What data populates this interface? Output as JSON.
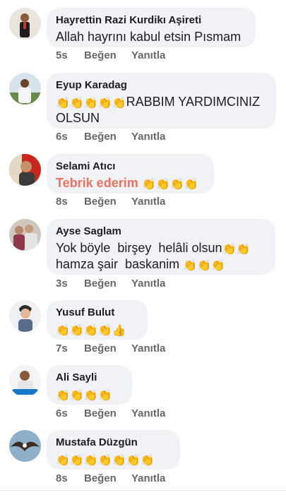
{
  "comments": [
    {
      "author": "Hayrettin Razi Kurdikı Aşireti",
      "text": "Allah hayrını kabul etsin Pısmam",
      "emojis": "",
      "time": "5s",
      "like": "Beğen",
      "reply": "Yanıtla",
      "avatar_icon": "man-in-suit-avatar-icon"
    },
    {
      "author": "Eyup Karadag",
      "text_line1": "RABBIM YARDIMCINIZ",
      "text_line2": "OLSUN",
      "emojis": "👏👏👏👏👏",
      "time": "6s",
      "like": "Beğen",
      "reply": "Yanıtla",
      "avatar_icon": "man-outdoors-avatar-icon"
    },
    {
      "author": "Selami Atıcı",
      "text": "Tebrik ederim",
      "emojis": "👏👏👏👏",
      "text_color": "#e9735f",
      "time": "8s",
      "like": "Beğen",
      "reply": "Yanıtla",
      "avatar_icon": "man-red-background-avatar-icon"
    },
    {
      "author": "Ayse Saglam",
      "text_line1": "Yok böyle  birşey  helâli olsun",
      "emojis_line1": "👏👏",
      "text_line2": "hamza şair  baskanim ",
      "emojis_line2": "👏👏👏",
      "time": "3s",
      "like": "Beğen",
      "reply": "Yanıtla",
      "avatar_icon": "woman-avatar-icon"
    },
    {
      "author": "Yusuf Bulut",
      "emojis": "👏👏👏👏👍",
      "time": "7s",
      "like": "Beğen",
      "reply": "Yanıtla",
      "avatar_icon": "young-man-avatar-icon"
    },
    {
      "author": "Ali Sayli",
      "emojis": "👏👏👏👏",
      "time": "6s",
      "like": "Beğen",
      "reply": "Yanıtla",
      "avatar_icon": "man-badge-avatar-icon"
    },
    {
      "author": "Mustafa Düzgün",
      "emojis": "👏👏👏👏👏👏👏",
      "time": "8s",
      "like": "Beğen",
      "reply": "Yanıtla",
      "avatar_icon": "eagle-avatar-icon"
    }
  ],
  "colors": {
    "bubble_bg": "#f0f2f5",
    "meta_text": "#65676b",
    "name_text": "#1c1e21",
    "highlight_text": "#e9735f"
  }
}
